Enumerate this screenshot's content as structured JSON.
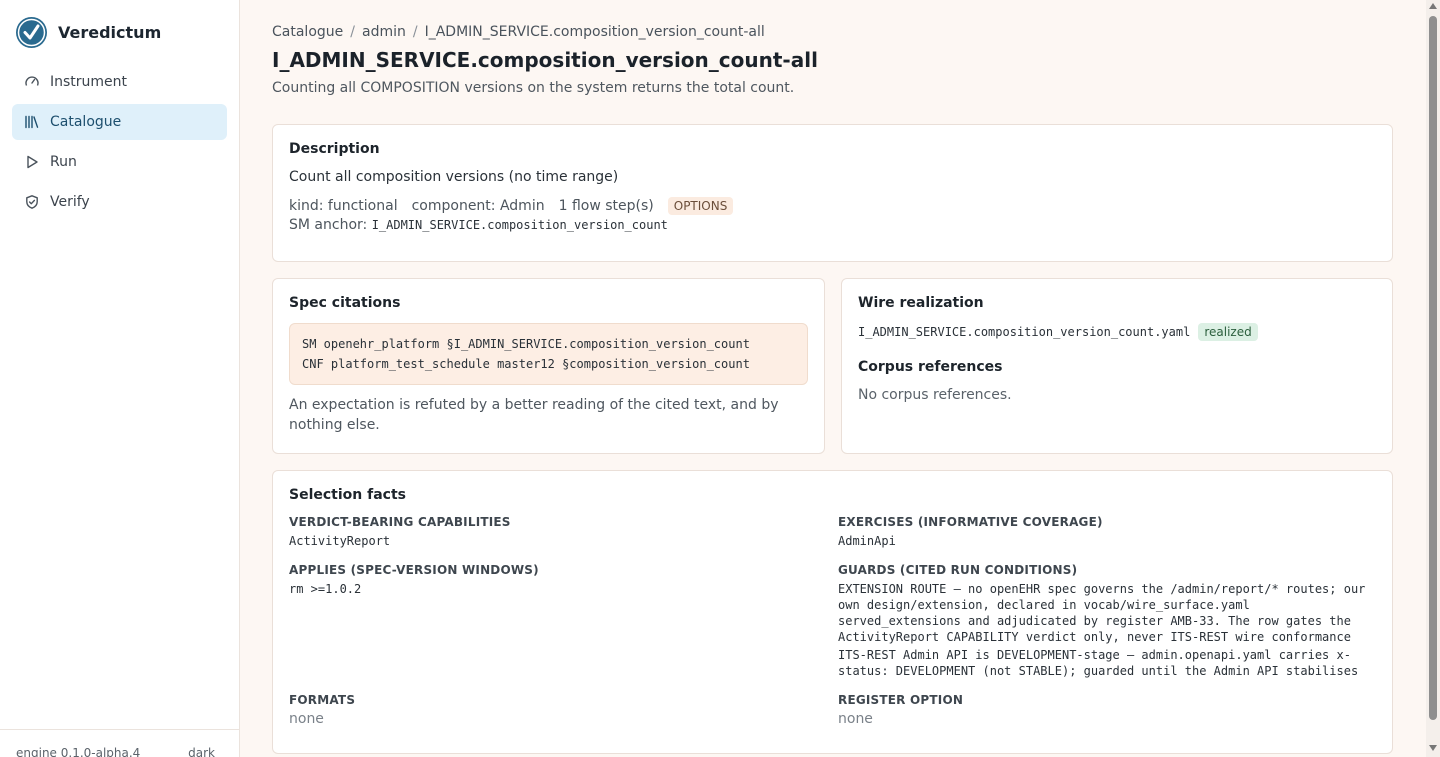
{
  "app": {
    "name": "Veredictum",
    "version": "engine 0.1.0-alpha.4",
    "theme_toggle": "dark",
    "logo_icon": "check-shield-logo",
    "accent_color": "#2a6a8f"
  },
  "sidebar": {
    "items": [
      {
        "label": "Instrument",
        "icon": "gauge-icon",
        "active": false
      },
      {
        "label": "Catalogue",
        "icon": "library-icon",
        "active": true
      },
      {
        "label": "Run",
        "icon": "play-icon",
        "active": false
      },
      {
        "label": "Verify",
        "icon": "shield-check-icon",
        "active": false
      }
    ]
  },
  "breadcrumb": {
    "items": [
      "Catalogue",
      "admin",
      "I_ADMIN_SERVICE.composition_version_count-all"
    ],
    "separator": "/"
  },
  "page": {
    "title": "I_ADMIN_SERVICE.composition_version_count-all",
    "subtitle": "Counting all COMPOSITION versions on the system returns the total count."
  },
  "description": {
    "heading": "Description",
    "text": "Count all composition versions (no time range)",
    "kind": "kind: functional",
    "component": "component: Admin",
    "flow_steps": "1 flow step(s)",
    "badge": "OPTIONS",
    "anchor_label": "SM anchor:",
    "anchor_value": "I_ADMIN_SERVICE.composition_version_count"
  },
  "spec_citations": {
    "heading": "Spec citations",
    "lines": [
      "SM openehr_platform §I_ADMIN_SERVICE.composition_version_count",
      "CNF platform_test_schedule master12 §composition_version_count"
    ],
    "note": "An expectation is refuted by a better reading of the cited text, and by nothing else."
  },
  "wire": {
    "heading": "Wire realization",
    "file": "I_ADMIN_SERVICE.composition_version_count.yaml",
    "status": "realized",
    "corpus_heading": "Corpus references",
    "corpus_text": "No corpus references."
  },
  "selection": {
    "heading": "Selection facts",
    "verdict_label": "VERDICT-BEARING CAPABILITIES",
    "verdict_value": "ActivityReport",
    "exercises_label": "EXERCISES (INFORMATIVE COVERAGE)",
    "exercises_value": "AdminApi",
    "applies_label": "APPLIES (SPEC-VERSION WINDOWS)",
    "applies_value": "rm >=1.0.2",
    "guards_label": "GUARDS (CITED RUN CONDITIONS)",
    "guards": [
      "EXTENSION ROUTE — no openEHR spec governs the /admin/report/* routes; our own design/extension, declared in vocab/wire_surface.yaml served_extensions and adjudicated by register AMB-33. The row gates the ActivityReport CAPABILITY verdict only, never ITS-REST wire conformance",
      "ITS-REST Admin API is DEVELOPMENT-stage — admin.openapi.yaml carries x-status: DEVELOPMENT (not STABLE); guarded until the Admin API stabilises"
    ],
    "formats_label": "FORMATS",
    "formats_value": "none",
    "register_label": "REGISTER OPTION",
    "register_value": "none"
  }
}
